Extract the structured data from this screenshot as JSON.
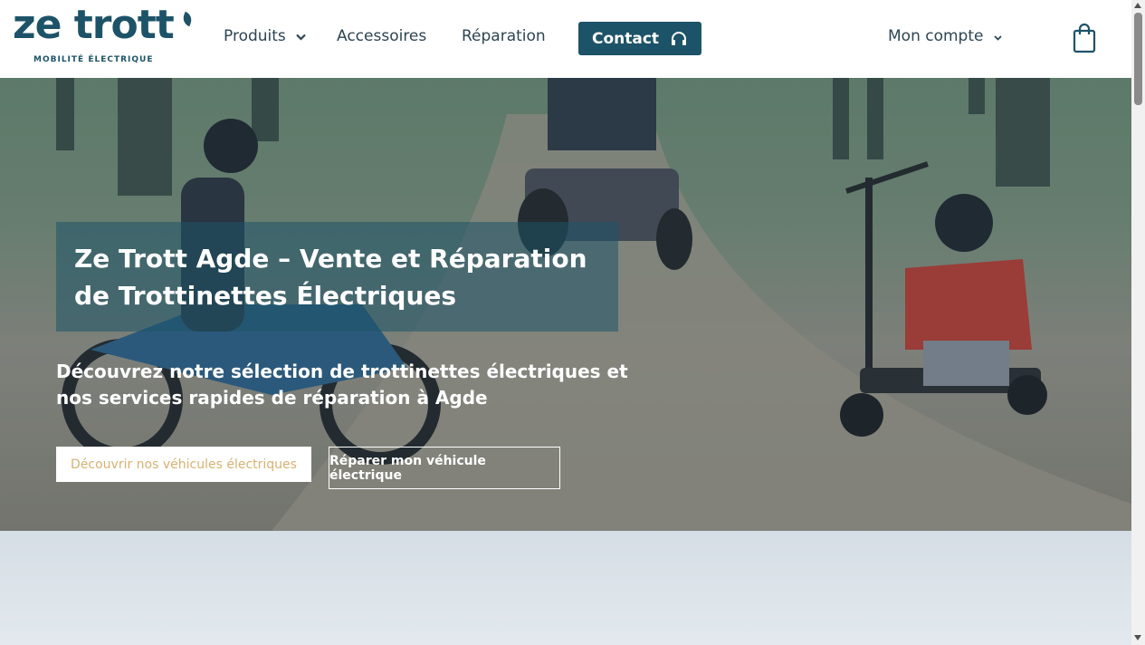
{
  "header": {
    "logo": {
      "wordmark": "ze trott",
      "tagline": "MOBILITÉ ÉLECTRIQUE"
    },
    "nav": {
      "produits": "Produits",
      "accessoires": "Accessoires",
      "reparation": "Réparation"
    },
    "contact_label": "Contact",
    "account_label": "Mon compte"
  },
  "hero": {
    "title": "Ze Trott Agde – Vente et Réparation de Trottinettes Électriques",
    "subtitle": "Découvrez notre sélection de trottinettes électriques et nos services rapides de réparation à Agde",
    "primary_button": "Découvrir nos véhicules électriques",
    "secondary_button": "Réparer mon véhicule électrique"
  },
  "icons": {
    "contact": "headphones-icon",
    "cart": "shopping-bag-icon",
    "dropdown": "chevron-down-icon"
  },
  "colors": {
    "brand": "#1d5368",
    "nav_text": "#2e4452",
    "primary_button_text": "#d8b172"
  }
}
